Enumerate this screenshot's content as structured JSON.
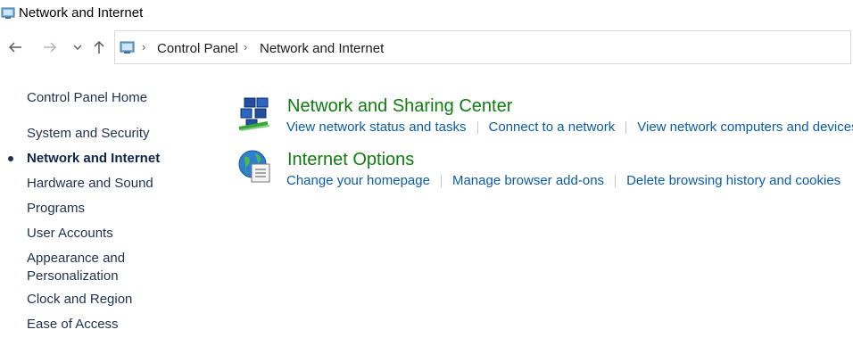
{
  "window": {
    "title": "Network and Internet"
  },
  "nav": {
    "back_icon": "back-arrow-icon",
    "forward_icon": "forward-arrow-icon",
    "recent_icon": "chevron-down-icon",
    "up_icon": "up-arrow-icon"
  },
  "breadcrumb": {
    "items": [
      "Control Panel",
      "Network and Internet"
    ]
  },
  "sidebar": {
    "items": [
      {
        "label": "Control Panel Home",
        "active": false
      },
      {
        "label": "System and Security",
        "active": false
      },
      {
        "label": "Network and Internet",
        "active": true
      },
      {
        "label": "Hardware and Sound",
        "active": false
      },
      {
        "label": "Programs",
        "active": false
      },
      {
        "label": "User Accounts",
        "active": false
      },
      {
        "label": "Appearance and\nPersonalization",
        "active": false
      },
      {
        "label": "Clock and Region",
        "active": false
      },
      {
        "label": "Ease of Access",
        "active": false
      }
    ]
  },
  "categories": [
    {
      "title": "Network and Sharing Center",
      "icon": "network-sharing-icon",
      "links": [
        "View network status and tasks",
        "Connect to a network",
        "View network computers and devices"
      ]
    },
    {
      "title": "Internet Options",
      "icon": "internet-options-icon",
      "links": [
        "Change your homepage",
        "Manage browser add-ons",
        "Delete browsing history and cookies"
      ]
    }
  ],
  "colors": {
    "category_title": "#107c10",
    "link": "#0b5ca8",
    "sidebar_text": "#1e3250"
  }
}
